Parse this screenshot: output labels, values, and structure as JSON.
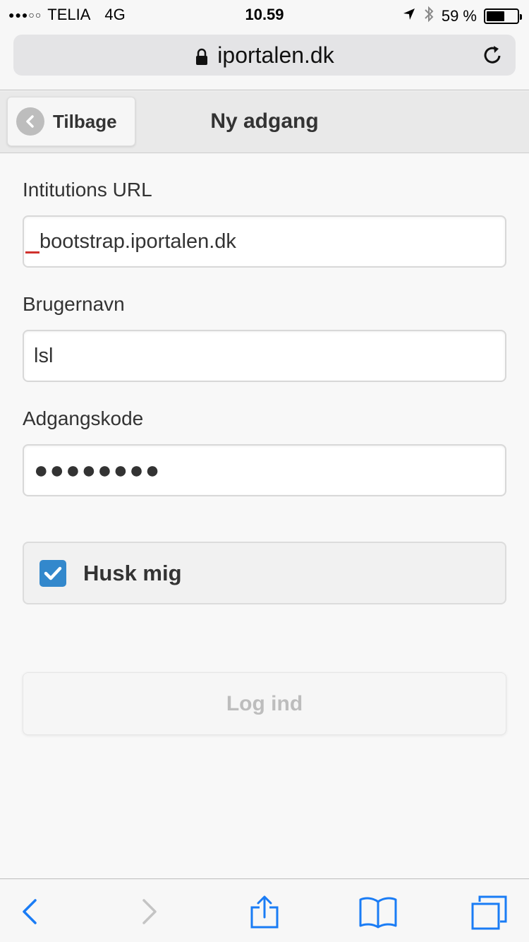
{
  "status_bar": {
    "signal": "●●●○○",
    "carrier": "TELIA",
    "network": "4G",
    "time": "10.59",
    "battery_percent": "59 %",
    "battery_level": 0.59
  },
  "browser": {
    "url": "iportalen.dk"
  },
  "header": {
    "back_label": "Tilbage",
    "title": "Ny adgang"
  },
  "form": {
    "institution_url_label": "Intitutions URL",
    "institution_url_value": "bootstrap.iportalen.dk",
    "username_label": "Brugernavn",
    "username_value": "lsl",
    "password_label": "Adgangskode",
    "password_value": "●●●●●●●●",
    "remember_label": "Husk mig",
    "remember_checked": true,
    "login_label": "Log ind"
  },
  "colors": {
    "accent": "#3388cc",
    "spellcheck": "#d0312d",
    "ios_blue": "#1a7cf5"
  }
}
